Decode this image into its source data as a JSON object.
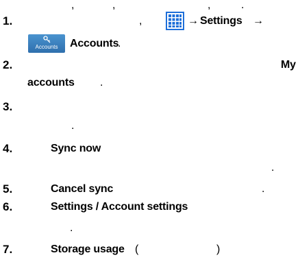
{
  "steps": [
    {
      "number": "1.",
      "nav": {
        "arrow1": "→",
        "settings": "Settings",
        "arrow2": "→",
        "accounts": "Accounts",
        "period": "."
      }
    },
    {
      "number": "2.",
      "bold_tail_a": "My",
      "bold_tail_b": "accounts",
      "period": "."
    },
    {
      "number": "3.",
      "period": "."
    },
    {
      "number": "4.",
      "label": "Sync now",
      "period": "."
    },
    {
      "number": "5.",
      "label": "Cancel sync",
      "period": "."
    },
    {
      "number": "6.",
      "label": "Settings / Account settings",
      "period": "."
    },
    {
      "number": "7.",
      "label": "Storage usage",
      "open_paren": "(",
      "close_paren": ")"
    }
  ],
  "step1_top_marks": [
    ",",
    ",",
    ",",
    "."
  ],
  "step1_comma": ",",
  "icons": {
    "apps": "apps-grid-icon",
    "accounts": "accounts-icon",
    "accounts_label": "Accounts"
  },
  "colors": {
    "apps_icon": "#1e6fd9",
    "accounts_icon": "#3a80c0"
  }
}
